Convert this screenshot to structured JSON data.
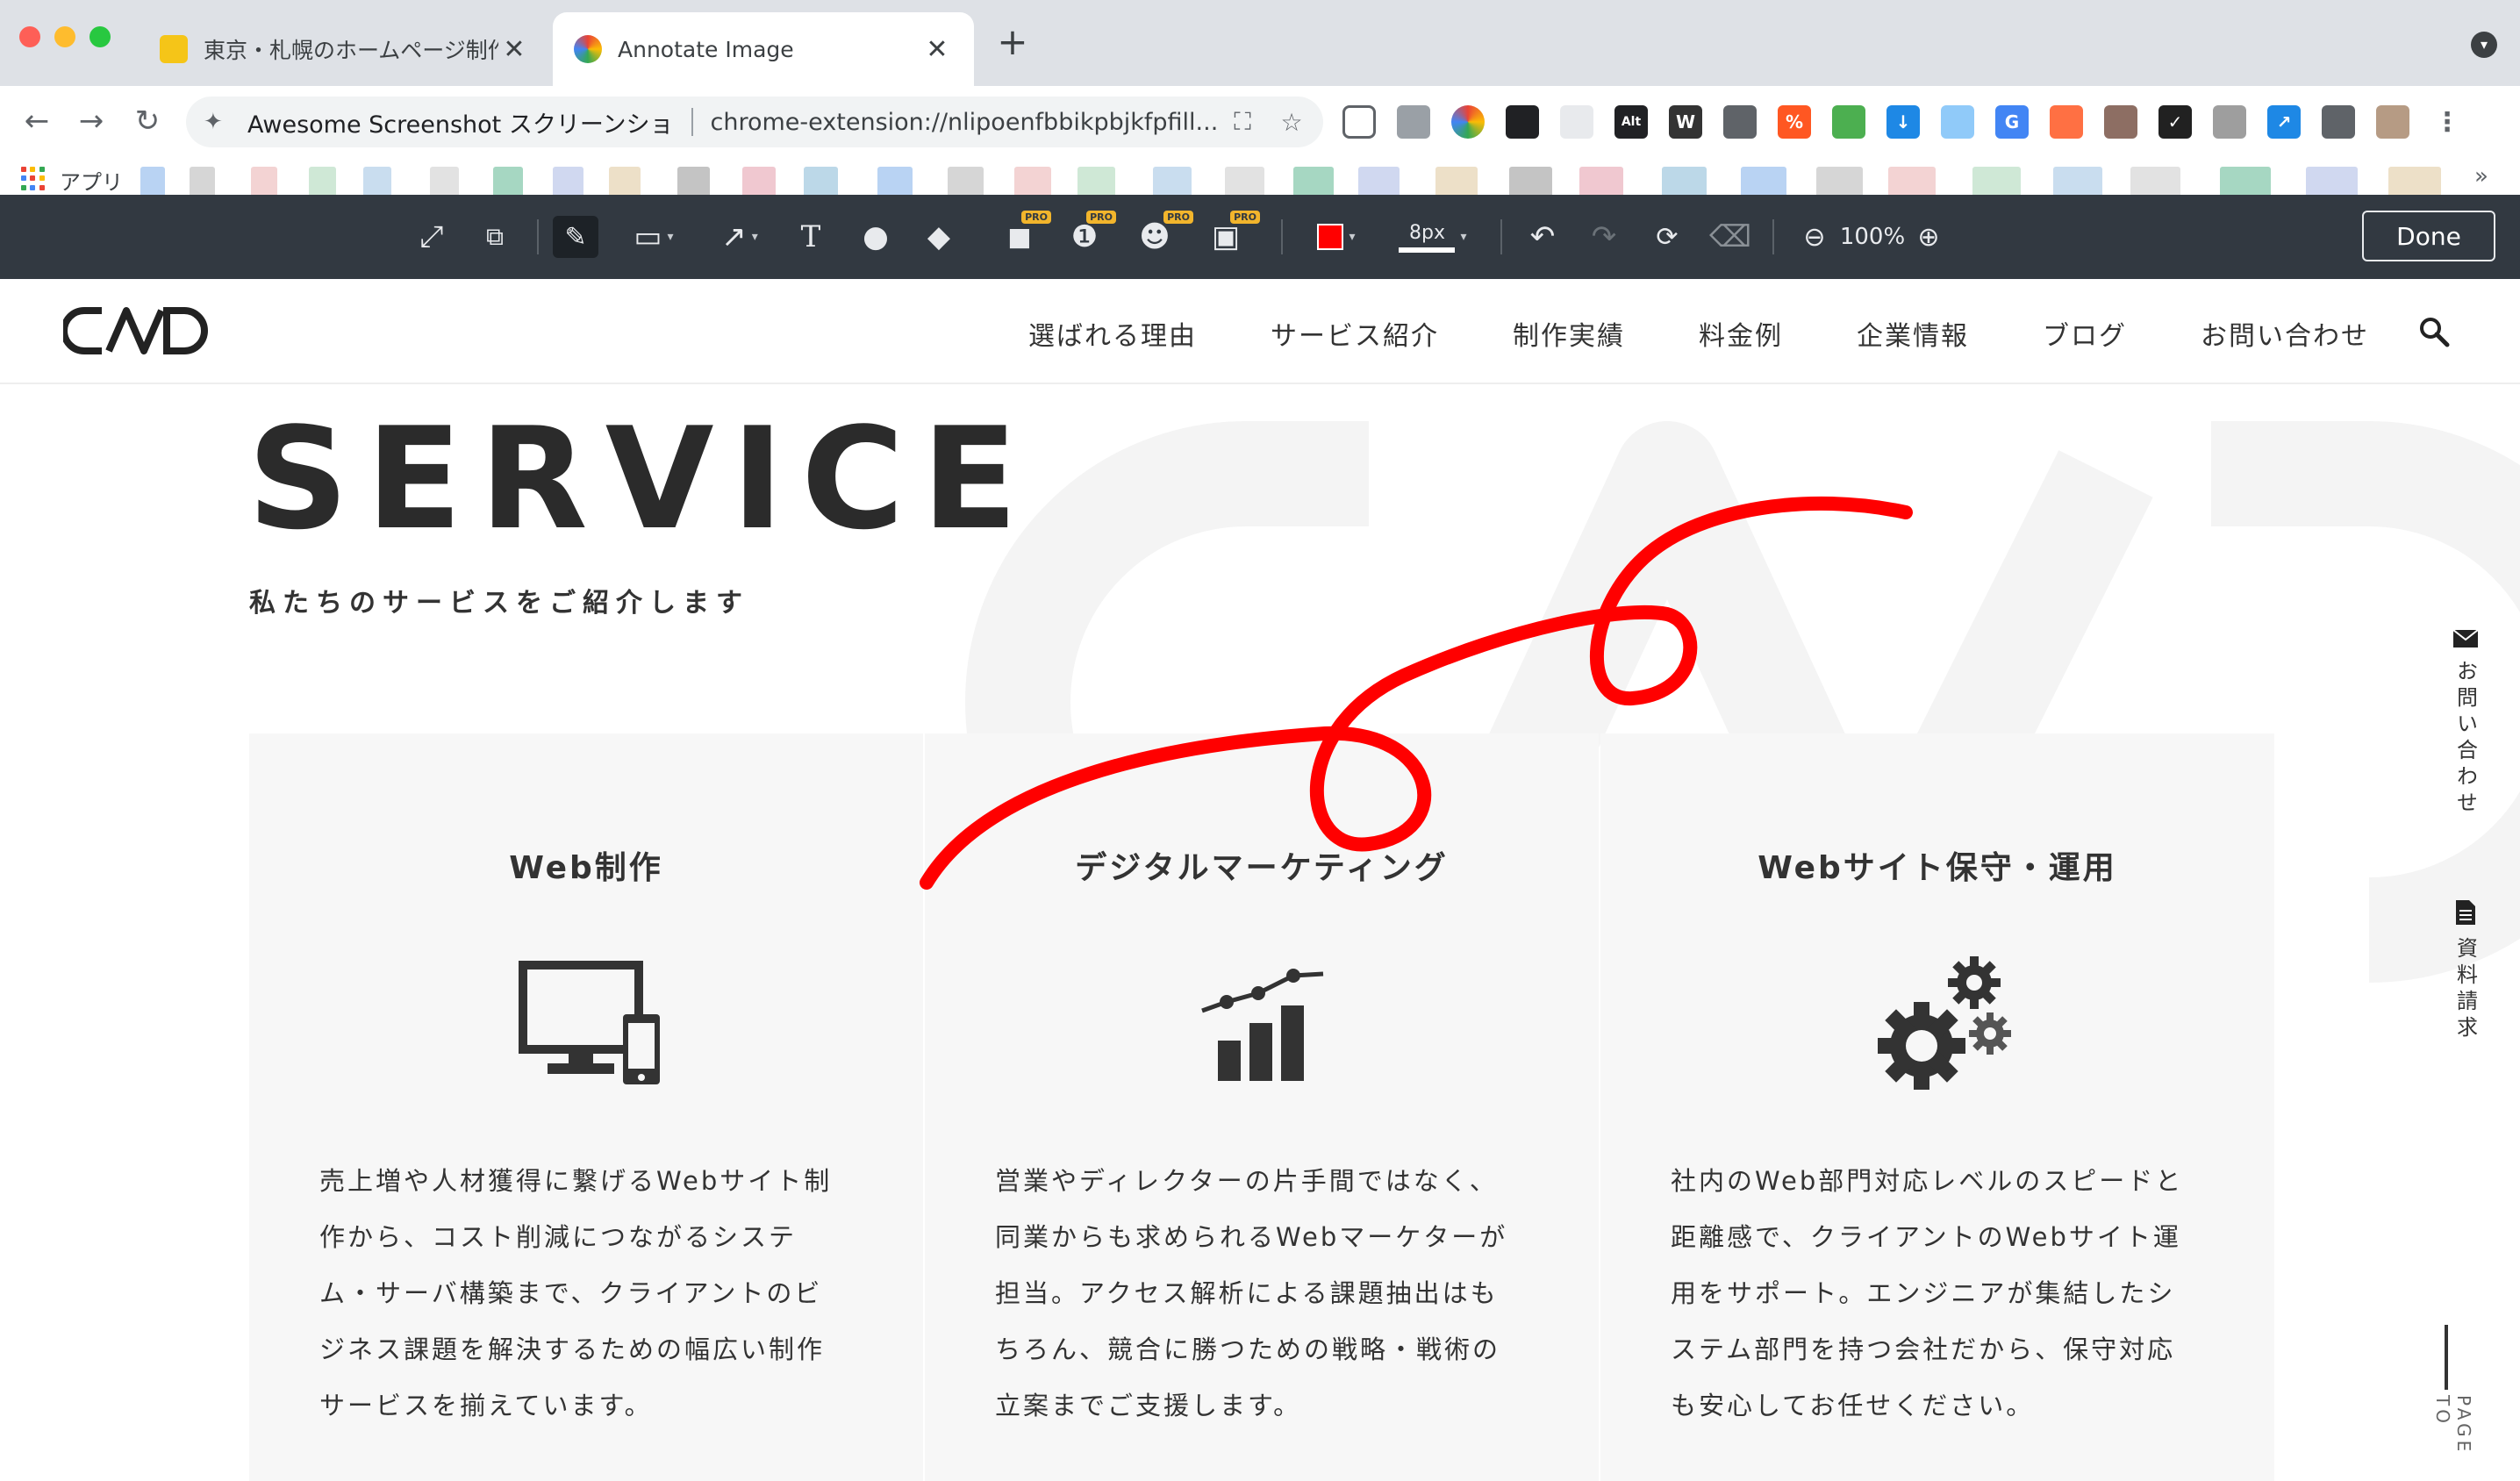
{
  "browser": {
    "tabs": [
      {
        "title": "東京・札幌のホームページ制作",
        "active": false
      },
      {
        "title": "Annotate Image",
        "active": true
      }
    ],
    "new_tab_symbol": "+",
    "close_symbol": "✕",
    "omnibox": {
      "site": "Awesome Screenshot スクリーンショ",
      "url": "chrome-extension://nlipoenfbbikpbjkfpfill..."
    },
    "apps_label": "アプリ",
    "more_symbol": "»"
  },
  "annotate_toolbar": {
    "pro_badge": "PRO",
    "pen_size": "8px",
    "zoom": "100%",
    "done_label": "Done",
    "active_color": "#ff0000"
  },
  "site": {
    "nav": [
      "選ばれる理由",
      "サービス紹介",
      "制作実績",
      "料金例",
      "企業情報",
      "ブログ",
      "お問い合わせ"
    ],
    "hero_title": "SERVICE",
    "hero_subtitle": "私たちのサービスをご紹介します",
    "cards": [
      {
        "title": "Web制作",
        "icon": "computer-devices-icon",
        "lines": [
          "売上増や人材獲得に繋げるWebサイト制",
          "作から、コスト削減につながるシステ",
          "ム・サーバ構築まで、クライアントのビ",
          "ジネス課題を解決するための幅広い制作",
          "サービスを揃えています。"
        ]
      },
      {
        "title": "デジタルマーケティング",
        "icon": "growth-chart-icon",
        "lines": [
          "営業やディレクターの片手間ではなく、",
          "同業からも求められるWebマーケターが",
          "担当。アクセス解析による課題抽出はも",
          "ちろん、競合に勝つための戦略・戦術の",
          "立案までご支援します。"
        ]
      },
      {
        "title": "Webサイト保守・運用",
        "icon": "gears-icon",
        "lines": [
          "社内のWeb部門対応レベルのスピードと",
          "距離感で、クライアントのWebサイト運",
          "用をサポート。エンジニアが集結したシ",
          "ステム部門を持つ会社だから、保守対応",
          "も安心してお任せください。"
        ]
      }
    ],
    "side_contact": "お問い合わせ",
    "side_docs": "資料請求",
    "page_top": "PAGE TO"
  },
  "colors": {
    "annotation_stroke": "#ff0000",
    "toolbar_bg": "#323941",
    "card_bg": "#f7f7f7"
  }
}
